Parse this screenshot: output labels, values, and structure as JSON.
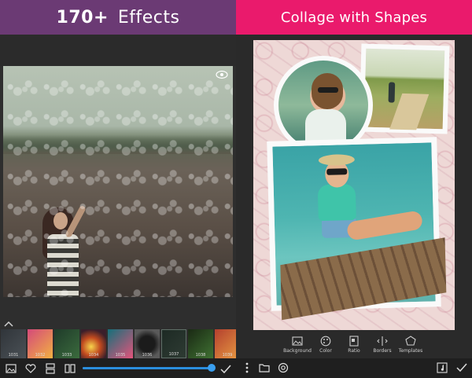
{
  "left_panel": {
    "banner": {
      "count": "170+",
      "label": "Effects",
      "color": "#6b3a74"
    },
    "preview": {
      "eye_icon": "eye-icon"
    },
    "effects": [
      {
        "label": "1031"
      },
      {
        "label": "1032"
      },
      {
        "label": "1033"
      },
      {
        "label": "1034"
      },
      {
        "label": "1035"
      },
      {
        "label": "1036"
      },
      {
        "label": "1037"
      },
      {
        "label": "1038"
      },
      {
        "label": "1039"
      }
    ],
    "slider": {
      "value": 1.0,
      "color": "#2b8ede"
    },
    "toolbar": {
      "icons": [
        "gallery-icon",
        "heart-icon",
        "compare-icon",
        "split-icon"
      ],
      "apply_icon": "check-icon"
    }
  },
  "right_panel": {
    "banner": {
      "title": "Collage with Shapes",
      "color": "#ea1a6c"
    },
    "tools": [
      {
        "label": "Background",
        "icon": "image-icon"
      },
      {
        "label": "Color",
        "icon": "palette-icon"
      },
      {
        "label": "Ratio",
        "icon": "ratio-icon"
      },
      {
        "label": "Borders",
        "icon": "borders-icon"
      },
      {
        "label": "Templates",
        "icon": "templates-icon"
      }
    ],
    "toolbar": {
      "icons": [
        "more-vert-icon",
        "folder-icon",
        "camera-icon",
        "music-icon"
      ],
      "apply_icon": "check-icon"
    }
  }
}
